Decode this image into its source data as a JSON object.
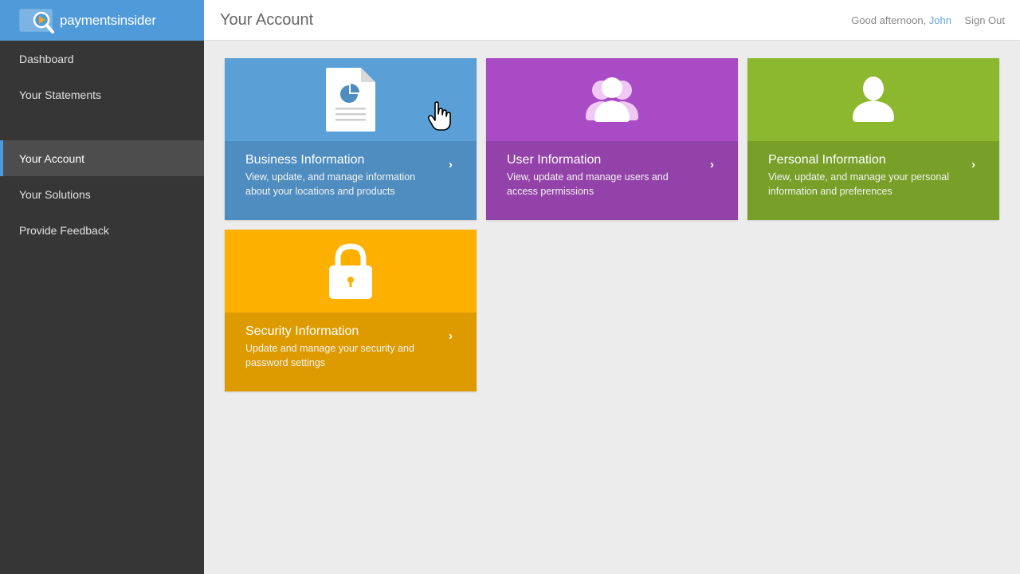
{
  "brand": {
    "name_part1": "payments",
    "name_part2": "insider",
    "color": "#4f9bd9"
  },
  "sidebar": {
    "items": [
      {
        "label": "Dashboard",
        "active": false
      },
      {
        "label": "Your Statements",
        "active": false
      },
      {
        "label": "Your Account",
        "active": true
      },
      {
        "label": "Your Solutions",
        "active": false
      },
      {
        "label": "Provide Feedback",
        "active": false
      }
    ]
  },
  "header": {
    "title": "Your Account",
    "greeting": "Good afternoon,",
    "user_name": "John",
    "sign_out": "Sign Out"
  },
  "tiles": [
    {
      "title": "Business Information",
      "description": "View, update, and manage information about your locations and products",
      "icon": "document-chart-icon",
      "color": "#5aa0d6"
    },
    {
      "title": "User Information",
      "description": "View, update and manage users and access permissions",
      "icon": "users-icon",
      "color": "#a94bc4"
    },
    {
      "title": "Personal Information",
      "description": "View, update, and manage your personal information and preferences",
      "icon": "user-icon",
      "color": "#8cb830"
    },
    {
      "title": "Security Information",
      "description": "Update and manage your security and password settings",
      "icon": "lock-icon",
      "color": "#fdb000"
    }
  ]
}
